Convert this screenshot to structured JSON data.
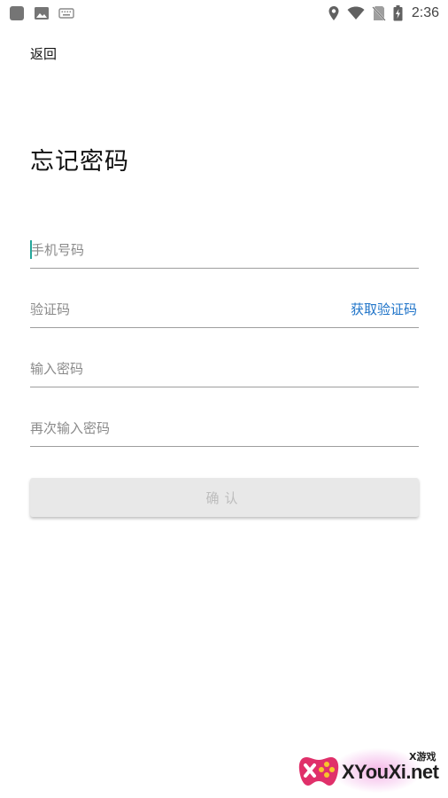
{
  "status_bar": {
    "time": "2:36",
    "icons_left": [
      "app-square-icon",
      "image-icon",
      "keyboard-icon"
    ],
    "icons_right": [
      "location-icon",
      "wifi-icon",
      "no-sim-icon",
      "battery-charging-icon"
    ]
  },
  "nav": {
    "back_label": "返回"
  },
  "page": {
    "title": "忘记密码"
  },
  "form": {
    "phone_placeholder": "手机号码",
    "code_placeholder": "验证码",
    "get_code_label": "获取验证码",
    "password_placeholder": "输入密码",
    "confirm_password_placeholder": "再次输入密码",
    "confirm_label": "确认"
  },
  "watermark": {
    "brand_text": "XYouXi.net",
    "sub_text": "X游戏"
  },
  "colors": {
    "accent_teal": "#26a69a",
    "link_blue": "#1e73c8",
    "button_bg": "#e8e8e8",
    "button_text": "#bdbdbd",
    "divider": "#9e9e9e"
  }
}
